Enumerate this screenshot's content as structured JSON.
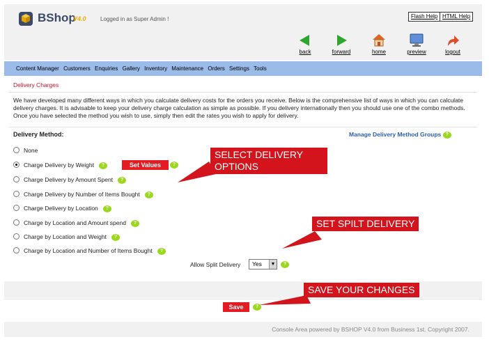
{
  "header": {
    "brand": "BShop",
    "version": "V4.0",
    "logged_in": "Logged in as Super Admin !",
    "flash_help": "Flash Help",
    "html_help": "HTML Help"
  },
  "nav": [
    {
      "label": "back",
      "icon": "arrow-left-icon"
    },
    {
      "label": "forward",
      "icon": "arrow-right-icon"
    },
    {
      "label": "home",
      "icon": "home-icon"
    },
    {
      "label": "preview",
      "icon": "monitor-icon"
    },
    {
      "label": "logout",
      "icon": "logout-arrow-icon"
    }
  ],
  "menu": [
    "Content Manager",
    "Customers",
    "Enquiries",
    "Gallery",
    "Inventory",
    "Maintenance",
    "Orders",
    "Settings",
    "Tools"
  ],
  "section_title": "Delivery Charges",
  "intro": "We have developed many different ways in which you calculate delivery costs for the orders you receive. Below is the comprehensive list of ways in which you can calculate delivery charges. It is advisable to keep your delivery charge calculation as simple as possible. If you delivery internationally then you should use one of the combo methods. Once you have selected the method you wish to use, simply then edit the rates you wish to apply for delivery.",
  "delivery_method_label": "Delivery Method:",
  "manage_link": "Manage Delivery Method Groups",
  "options": [
    {
      "label": "None",
      "checked": false,
      "help": false
    },
    {
      "label": "Charge Delivery by Weight",
      "checked": true,
      "help": true
    },
    {
      "label": "Charge Delivery by Amount Spent",
      "checked": false,
      "help": true
    },
    {
      "label": "Charge Delivery by Number of Items Bought",
      "checked": false,
      "help": true
    },
    {
      "label": "Charge Delivery by Location",
      "checked": false,
      "help": true
    },
    {
      "label": "Charge by Location and Amount spend",
      "checked": false,
      "help": true
    },
    {
      "label": "Charge by Location and Weight",
      "checked": false,
      "help": true
    },
    {
      "label": "Charge by Location and Number of Items Bought",
      "checked": false,
      "help": true
    }
  ],
  "set_values": "Set Values",
  "split": {
    "label": "Allow Split Delivery",
    "value": "Yes"
  },
  "save": "Save",
  "callouts": {
    "select": "SELECT DELIVERY OPTIONS",
    "split": "SET SPILT DELIVERY",
    "save": "SAVE YOUR CHANGES"
  },
  "help_glyph": "?",
  "select_arrow": "▼",
  "footer": "Console Area powered by BSHOP V4.0 from Business 1st. Copyright 2007.",
  "colors": {
    "accent_red": "#e31b23",
    "menu_blue": "#9bbbe8",
    "link_blue": "#2d5fb0",
    "help_green": "#9bd81c"
  }
}
